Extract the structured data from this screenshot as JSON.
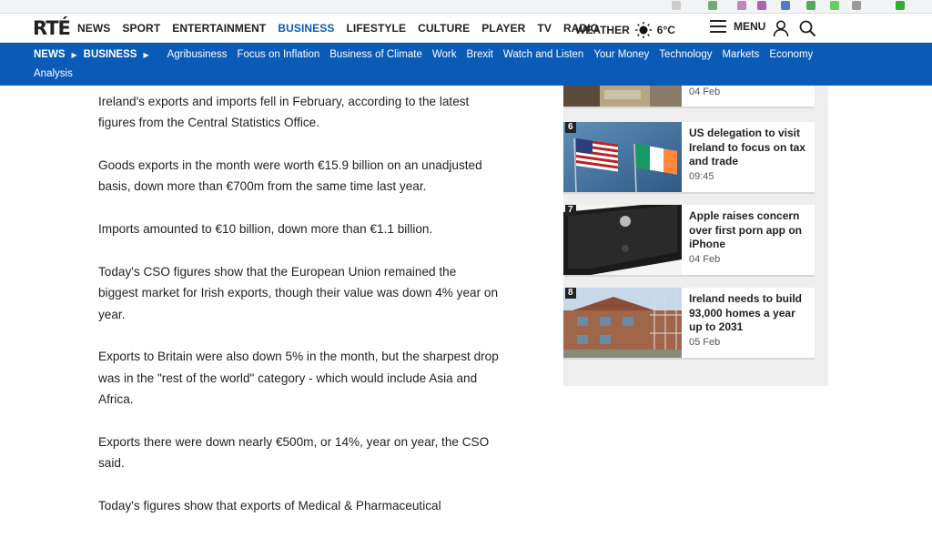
{
  "brand": {
    "logo": "RTÉ"
  },
  "mainnav": {
    "items": [
      {
        "label": "NEWS"
      },
      {
        "label": "SPORT"
      },
      {
        "label": "ENTERTAINMENT"
      },
      {
        "label": "BUSINESS",
        "active": true
      },
      {
        "label": "LIFESTYLE"
      },
      {
        "label": "CULTURE"
      },
      {
        "label": "PLAYER"
      },
      {
        "label": "TV"
      },
      {
        "label": "RADIO"
      }
    ],
    "weather_label": "WEATHER",
    "weather_temp": "6°C",
    "menu_label": "MENU"
  },
  "subnav": {
    "crumb_news": "NEWS",
    "crumb_business": "BUSINESS",
    "links": [
      "Agribusiness",
      "Focus on Inflation",
      "Business of Climate",
      "Work",
      "Brexit",
      "Watch and Listen",
      "Your Money",
      "Technology",
      "Markets",
      "Economy"
    ],
    "overflow_link": "Analysis"
  },
  "article": {
    "paragraphs": [
      "Ireland's exports and imports fell in February, according to the latest figures from the Central Statistics Office.",
      "Goods exports in the month were worth €15.9 billion on an unadjusted basis, down more than €700m from the same time last year.",
      "Imports amounted to €10 billion, down more than €1.1 billion.",
      "Today's CSO figures show that the European Union remained the biggest market for Irish exports, though their value was down 4% year on year.",
      "Exports to Britain were also down 5% in the month, but the sharpest drop was in the \"rest of the world\" category - which would include Asia and Africa.",
      "Exports there were down nearly €500m, or 14%, year on year, the CSO said.",
      "Today's figures show that exports of Medical & Pharmaceutical"
    ]
  },
  "sidebar": {
    "partial_date": "04 Feb",
    "cards": [
      {
        "num": "6",
        "title": "US delegation to visit Ireland to focus on tax and trade",
        "date": "09:45"
      },
      {
        "num": "7",
        "title": "Apple raises concern over first porn app on iPhone",
        "date": "04 Feb"
      },
      {
        "num": "8",
        "title": "Ireland needs to build 93,000 homes a year up to 2031",
        "date": "05 Feb"
      }
    ]
  },
  "colors": {
    "accent": "#0a5bb8"
  }
}
